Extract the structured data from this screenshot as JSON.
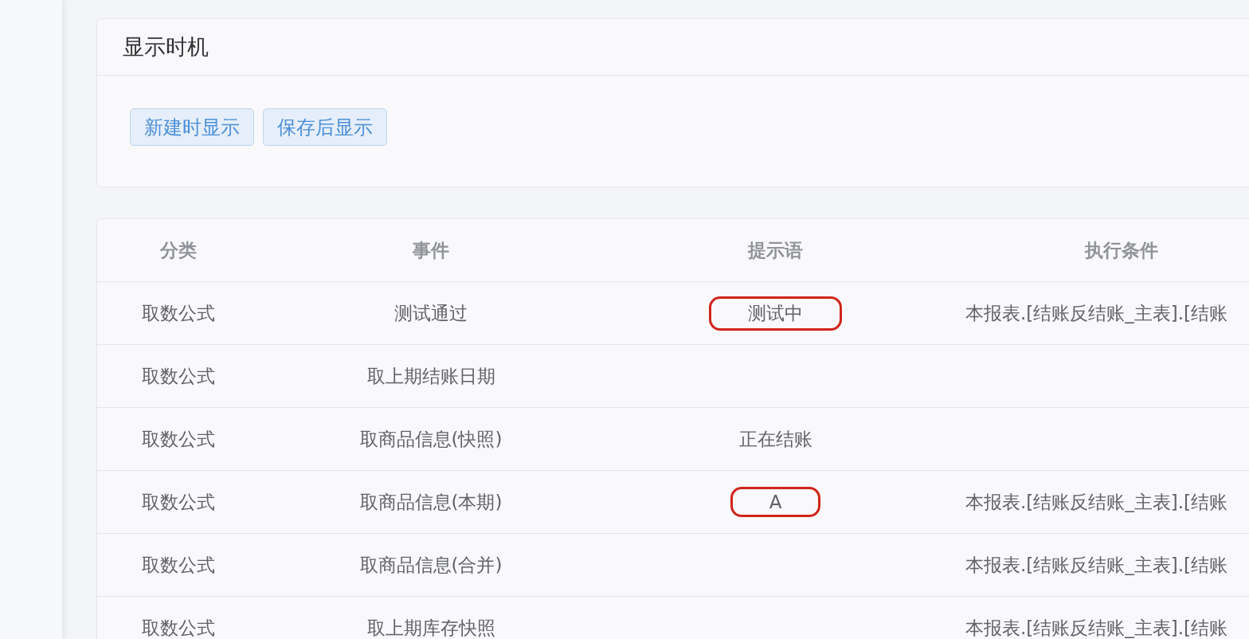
{
  "timing_card": {
    "title": "显示时机",
    "buttons": [
      {
        "label": "新建时显示"
      },
      {
        "label": "保存后显示"
      }
    ]
  },
  "table": {
    "columns": [
      "分类",
      "事件",
      "提示语",
      "执行条件"
    ],
    "rows": [
      {
        "category": "取数公式",
        "event": "测试通过",
        "tip": "测试中",
        "tip_highlighted": true,
        "condition": "本报表.[结账反结账_主表].[结账"
      },
      {
        "category": "取数公式",
        "event": "取上期结账日期",
        "tip_highlighted": false
      },
      {
        "category": "取数公式",
        "event": "取商品信息(快照)",
        "tip": "正在结账",
        "tip_highlighted": false
      },
      {
        "category": "取数公式",
        "event": "取商品信息(本期)",
        "tip": "A",
        "tip_highlighted": true,
        "condition": "本报表.[结账反结账_主表].[结账"
      },
      {
        "category": "取数公式",
        "event": "取商品信息(合并)",
        "tip_highlighted": false,
        "condition": "本报表.[结账反结账_主表].[结账"
      },
      {
        "category": "取数公式",
        "event": "取上期库存快照",
        "tip_highlighted": false,
        "condition": "本报表.[结账反结账_主表].[结账"
      }
    ]
  }
}
